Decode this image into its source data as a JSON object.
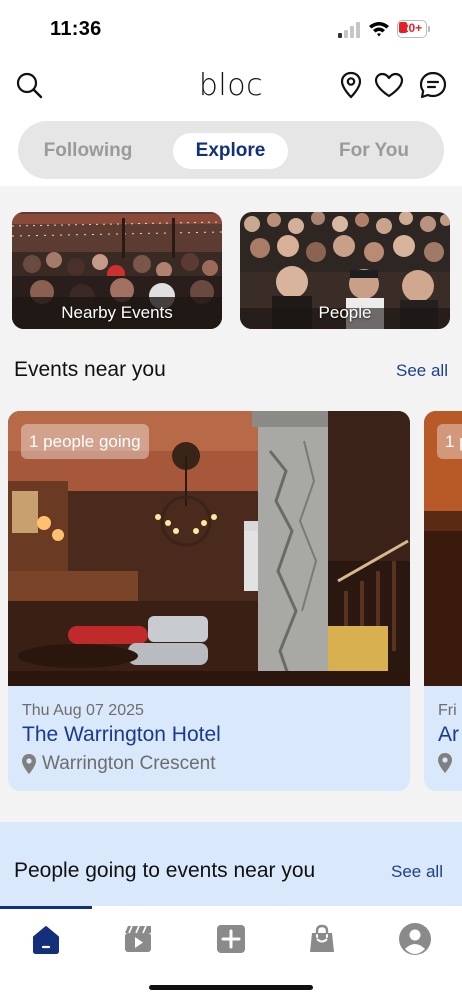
{
  "status_bar": {
    "time": "11:36",
    "battery": "20+"
  },
  "header": {
    "logo": "bloc",
    "icons": [
      "search-icon",
      "location-pin-icon",
      "heart-icon",
      "chat-icon"
    ]
  },
  "tabs": [
    {
      "label": "Following",
      "active": false
    },
    {
      "label": "Explore",
      "active": true
    },
    {
      "label": "For You",
      "active": false
    }
  ],
  "categories": [
    {
      "label": "Nearby Events"
    },
    {
      "label": "People"
    }
  ],
  "events_section": {
    "title": "Events near you",
    "see_all": "See all"
  },
  "events": [
    {
      "going": "1 people going",
      "date": "Thu Aug 07 2025",
      "title": "The Warrington Hotel",
      "location": "Warrington Crescent"
    },
    {
      "going": "1 p",
      "date": "Fri",
      "title": "Ar",
      "location": ""
    }
  ],
  "people_section": {
    "title": "People going to events near you",
    "see_all": "See all"
  },
  "bottom_nav": [
    {
      "name": "home",
      "icon": "home-icon",
      "active": true
    },
    {
      "name": "video",
      "icon": "clapperboard-icon",
      "active": false
    },
    {
      "name": "create",
      "icon": "plus-square-icon",
      "active": false
    },
    {
      "name": "shop",
      "icon": "shopping-bag-icon",
      "active": false
    },
    {
      "name": "profile",
      "icon": "user-circle-icon",
      "active": false
    }
  ],
  "colors": {
    "accent": "#15307a",
    "link": "#1d3f8f",
    "card_bg": "#d9e8fb",
    "battery": "#e5202a"
  }
}
